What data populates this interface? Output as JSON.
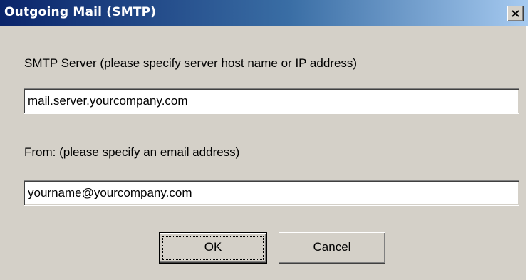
{
  "window": {
    "title": "Outgoing Mail (SMTP)",
    "close_icon": "close-icon"
  },
  "form": {
    "smtp_label": "SMTP Server  (please specify server host name or IP address)",
    "smtp_value": "mail.server.yourcompany.com",
    "from_label": "From:  (please specify an email address)",
    "from_value": "yourname@yourcompany.com"
  },
  "buttons": {
    "ok_label": "OK",
    "cancel_label": "Cancel"
  },
  "colors": {
    "title_gradient_start": "#0a246a",
    "title_gradient_end": "#a6caf0",
    "dialog_face": "#d4d0c8"
  }
}
